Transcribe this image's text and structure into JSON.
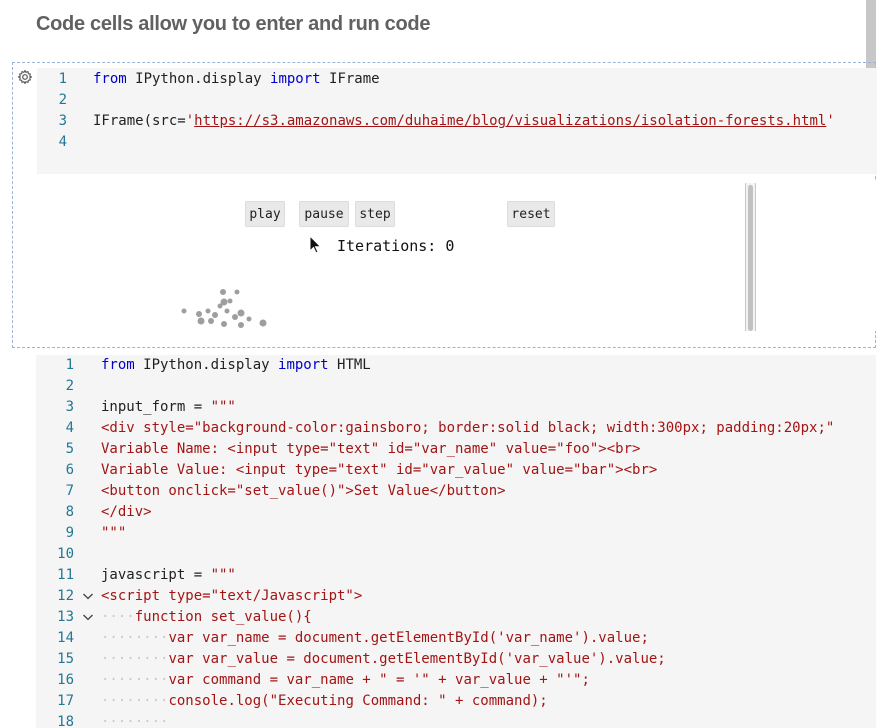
{
  "heading": "Code cells allow you to enter and run code",
  "cell1": {
    "lines": [
      {
        "n": "1",
        "parts": [
          {
            "t": "from",
            "c": "kw"
          },
          {
            "t": " IPython.display ",
            "c": ""
          },
          {
            "t": "import",
            "c": "kw"
          },
          {
            "t": " IFrame",
            "c": ""
          }
        ]
      },
      {
        "n": "2",
        "parts": []
      },
      {
        "n": "3",
        "parts": [
          {
            "t": "IFrame(src=",
            "c": ""
          },
          {
            "t": "'",
            "c": "str"
          },
          {
            "t": "https://s3.amazonaws.com/duhaime/blog/visualizations/isolation-forests.html",
            "c": "url"
          },
          {
            "t": "'",
            "c": "str"
          }
        ]
      },
      {
        "n": "4",
        "parts": []
      }
    ],
    "output": {
      "buttons": {
        "play": "play",
        "pause": "pause",
        "step": "step",
        "reset": "reset"
      },
      "iterations_label": "Iterations: 0"
    }
  },
  "cell2": {
    "lines": [
      {
        "n": "1",
        "parts": [
          {
            "t": "from",
            "c": "kw"
          },
          {
            "t": " IPython.display ",
            "c": ""
          },
          {
            "t": "import",
            "c": "kw"
          },
          {
            "t": " HTML",
            "c": ""
          }
        ]
      },
      {
        "n": "2",
        "parts": []
      },
      {
        "n": "3",
        "parts": [
          {
            "t": "input_form = ",
            "c": ""
          },
          {
            "t": "\"\"\"",
            "c": "str"
          }
        ]
      },
      {
        "n": "4",
        "parts": [
          {
            "t": "<div style=\"background-color:gainsboro; border:solid black; width:300px; padding:20px;\"",
            "c": "str"
          }
        ]
      },
      {
        "n": "5",
        "parts": [
          {
            "t": "Variable Name: <input type=\"text\" id=\"var_name\" value=\"foo\"><br>",
            "c": "str"
          }
        ]
      },
      {
        "n": "6",
        "parts": [
          {
            "t": "Variable Value: <input type=\"text\" id=\"var_value\" value=\"bar\"><br>",
            "c": "str"
          }
        ]
      },
      {
        "n": "7",
        "parts": [
          {
            "t": "<button onclick=\"set_value()\">Set Value</button>",
            "c": "str"
          }
        ]
      },
      {
        "n": "8",
        "parts": [
          {
            "t": "</div>",
            "c": "str"
          }
        ]
      },
      {
        "n": "9",
        "parts": [
          {
            "t": "\"\"\"",
            "c": "str"
          }
        ]
      },
      {
        "n": "10",
        "parts": []
      },
      {
        "n": "11",
        "parts": [
          {
            "t": "javascript = ",
            "c": ""
          },
          {
            "t": "\"\"\"",
            "c": "str"
          }
        ]
      },
      {
        "n": "12",
        "parts": [
          {
            "t": "<script type=\"text/Javascript\">",
            "c": "str"
          }
        ]
      },
      {
        "n": "13",
        "parts": [
          {
            "t": "····",
            "c": "ig"
          },
          {
            "t": "function set_value(){",
            "c": "str"
          }
        ]
      },
      {
        "n": "14",
        "parts": [
          {
            "t": "········",
            "c": "ig"
          },
          {
            "t": "var var_name = document.getElementById('var_name').value;",
            "c": "str"
          }
        ]
      },
      {
        "n": "15",
        "parts": [
          {
            "t": "········",
            "c": "ig"
          },
          {
            "t": "var var_value = document.getElementById('var_value').value;",
            "c": "str"
          }
        ]
      },
      {
        "n": "16",
        "parts": [
          {
            "t": "········",
            "c": "ig"
          },
          {
            "t": "var command = var_name + \" = '\" + var_value + \"'\";",
            "c": "str"
          }
        ]
      },
      {
        "n": "17",
        "parts": [
          {
            "t": "········",
            "c": "ig"
          },
          {
            "t": "console.log(\"Executing Command: \" + command);",
            "c": "str"
          }
        ]
      },
      {
        "n": "18",
        "parts": [
          {
            "t": "········",
            "c": "ig"
          }
        ]
      }
    ]
  },
  "icons": [
    "gear-icon",
    "mouse-cursor-icon",
    "fold-chevron-icon"
  ]
}
